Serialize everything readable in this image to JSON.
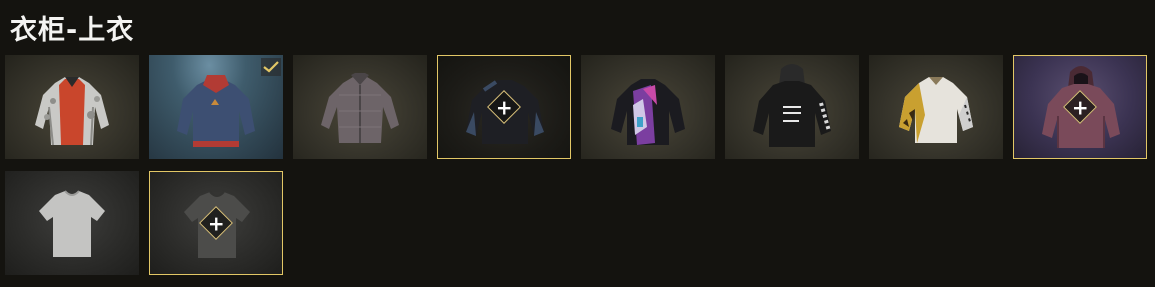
{
  "header": {
    "title": "衣柜-上衣"
  },
  "colors": {
    "selected_border": "#e2c766",
    "background": "#14130f"
  },
  "items": [
    {
      "name": "red-white-camo-jacket",
      "state": "normal",
      "icon": "jacket-icon"
    },
    {
      "name": "blue-sweater",
      "state": "equipped",
      "icon": "sweater-icon",
      "badge_icon": "check-icon"
    },
    {
      "name": "grey-button-shirt",
      "state": "normal",
      "icon": "shirt-icon"
    },
    {
      "name": "black-sweater",
      "state": "selected",
      "icon": "sweater-icon",
      "add_label": "+"
    },
    {
      "name": "purple-patch-jacket",
      "state": "normal",
      "icon": "jacket-icon"
    },
    {
      "name": "black-hoodie",
      "state": "normal",
      "icon": "hoodie-icon"
    },
    {
      "name": "gold-white-jacket",
      "state": "normal",
      "icon": "jacket-icon"
    },
    {
      "name": "maroon-hoodie",
      "state": "selected",
      "icon": "hoodie-icon",
      "add_label": "+"
    },
    {
      "name": "white-tshirt",
      "state": "normal",
      "icon": "tshirt-icon"
    },
    {
      "name": "grey-tshirt",
      "state": "selected",
      "icon": "tshirt-icon",
      "add_label": "+"
    }
  ]
}
